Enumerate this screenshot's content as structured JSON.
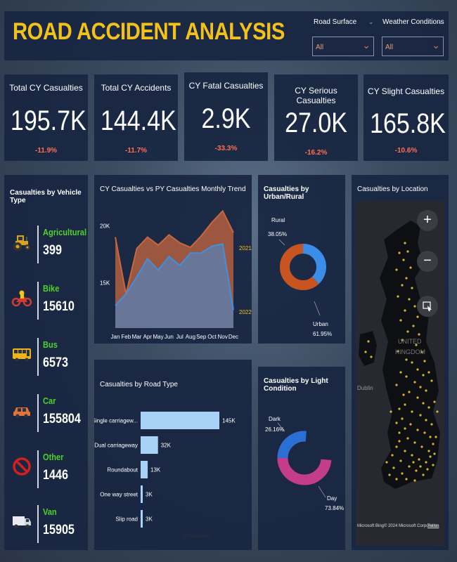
{
  "header": {
    "title": "ROAD ACCIDENT ANALYSIS"
  },
  "filters": [
    {
      "label": "Road Surface",
      "value": "All"
    },
    {
      "label": "Weather Conditions",
      "value": "All"
    }
  ],
  "kpis": [
    {
      "title": "Total CY Casualties",
      "value": "195.7K",
      "change": "-11.9%"
    },
    {
      "title": "Total CY Accidents",
      "value": "144.4K",
      "change": "-11.7%"
    },
    {
      "title": "CY Fatal Casualties",
      "value": "2.9K",
      "change": "-33.3%"
    },
    {
      "title": "CY Serious Casualties",
      "value": "27.0K",
      "change": "-16.2%"
    },
    {
      "title": "CY Slight Casualties",
      "value": "165.8K",
      "change": "-10.6%"
    }
  ],
  "vehicles": {
    "title": "Casualties by Vehicle Type",
    "items": [
      {
        "name": "Agricultural",
        "value": "399",
        "icon": "tractor-icon"
      },
      {
        "name": "Bike",
        "value": "15610",
        "icon": "motorbike-icon"
      },
      {
        "name": "Bus",
        "value": "6573",
        "icon": "bus-icon"
      },
      {
        "name": "Car",
        "value": "155804",
        "icon": "car-icon"
      },
      {
        "name": "Other",
        "value": "1446",
        "icon": "prohibited-icon"
      },
      {
        "name": "Van",
        "value": "15905",
        "icon": "van-icon"
      }
    ]
  },
  "trend": {
    "title": "CY Casualties vs PY Casualties Monthly Trend",
    "label_2021": "2021",
    "label_2022": "2022",
    "colors": {
      "py": "#c8673f",
      "cy": "#3f90e0"
    }
  },
  "urban": {
    "title": "Casualties by Urban/Rural",
    "rural_label": "Rural",
    "rural_pct": "38.05%",
    "urban_label": "Urban",
    "urban_pct": "61.95%",
    "colors": {
      "rural": "#3a8ee8",
      "urban": "#c8541f"
    }
  },
  "road": {
    "title": "Casualties by Road Type",
    "axis_label": "CY Casualties",
    "bar_color": "#a9d2f7"
  },
  "light": {
    "title": "Casualties by Light Condition",
    "dark_label": "Dark",
    "dark_pct": "26.16%",
    "day_label": "Day",
    "day_pct": "73.84%",
    "colors": {
      "dark": "#2a6fd4",
      "day": "#c43c8c"
    }
  },
  "location": {
    "title": "Casualties by Location",
    "map_label_1": "UNITED",
    "map_label_2": "KINGDOM",
    "city_1": "Dublin",
    "copyright": "© 2024 Microsoft Corporation",
    "terms": "Terms",
    "brand": "Microsoft Bing"
  },
  "chart_data": [
    {
      "type": "area",
      "title": "CY Casualties vs PY Casualties Monthly Trend",
      "categories": [
        "Jan",
        "Feb",
        "Mar",
        "Apr",
        "May",
        "Jun",
        "Jul",
        "Aug",
        "Sep",
        "Oct",
        "Nov",
        "Dec"
      ],
      "yticks": [
        "15K",
        "20K"
      ],
      "ylim": [
        11000,
        22000
      ],
      "series": [
        {
          "name": "2021",
          "values": [
            19000,
            14000,
            18000,
            19000,
            18300,
            19200,
            18500,
            18100,
            19100,
            20300,
            21300,
            19400
          ]
        },
        {
          "name": "2022",
          "values": [
            13000,
            14000,
            15500,
            17100,
            16100,
            17300,
            16500,
            17600,
            17600,
            18200,
            18400,
            12600
          ]
        }
      ]
    },
    {
      "type": "pie",
      "title": "Casualties by Urban/Rural",
      "labels": [
        "Rural",
        "Urban"
      ],
      "values": [
        38.05,
        61.95
      ]
    },
    {
      "type": "bar",
      "title": "Casualties by Road Type",
      "categories": [
        "Single carriagew...",
        "Dual carriageway",
        "Roundabout",
        "One way street",
        "Slip road"
      ],
      "values": [
        145000,
        32000,
        13000,
        3000,
        3000
      ],
      "value_labels": [
        "145K",
        "32K",
        "13K",
        "3K",
        "3K"
      ],
      "xlabel": "CY Casualties"
    },
    {
      "type": "pie",
      "title": "Casualties by Light Condition",
      "labels": [
        "Dark",
        "Day"
      ],
      "values": [
        26.16,
        73.84
      ]
    }
  ]
}
